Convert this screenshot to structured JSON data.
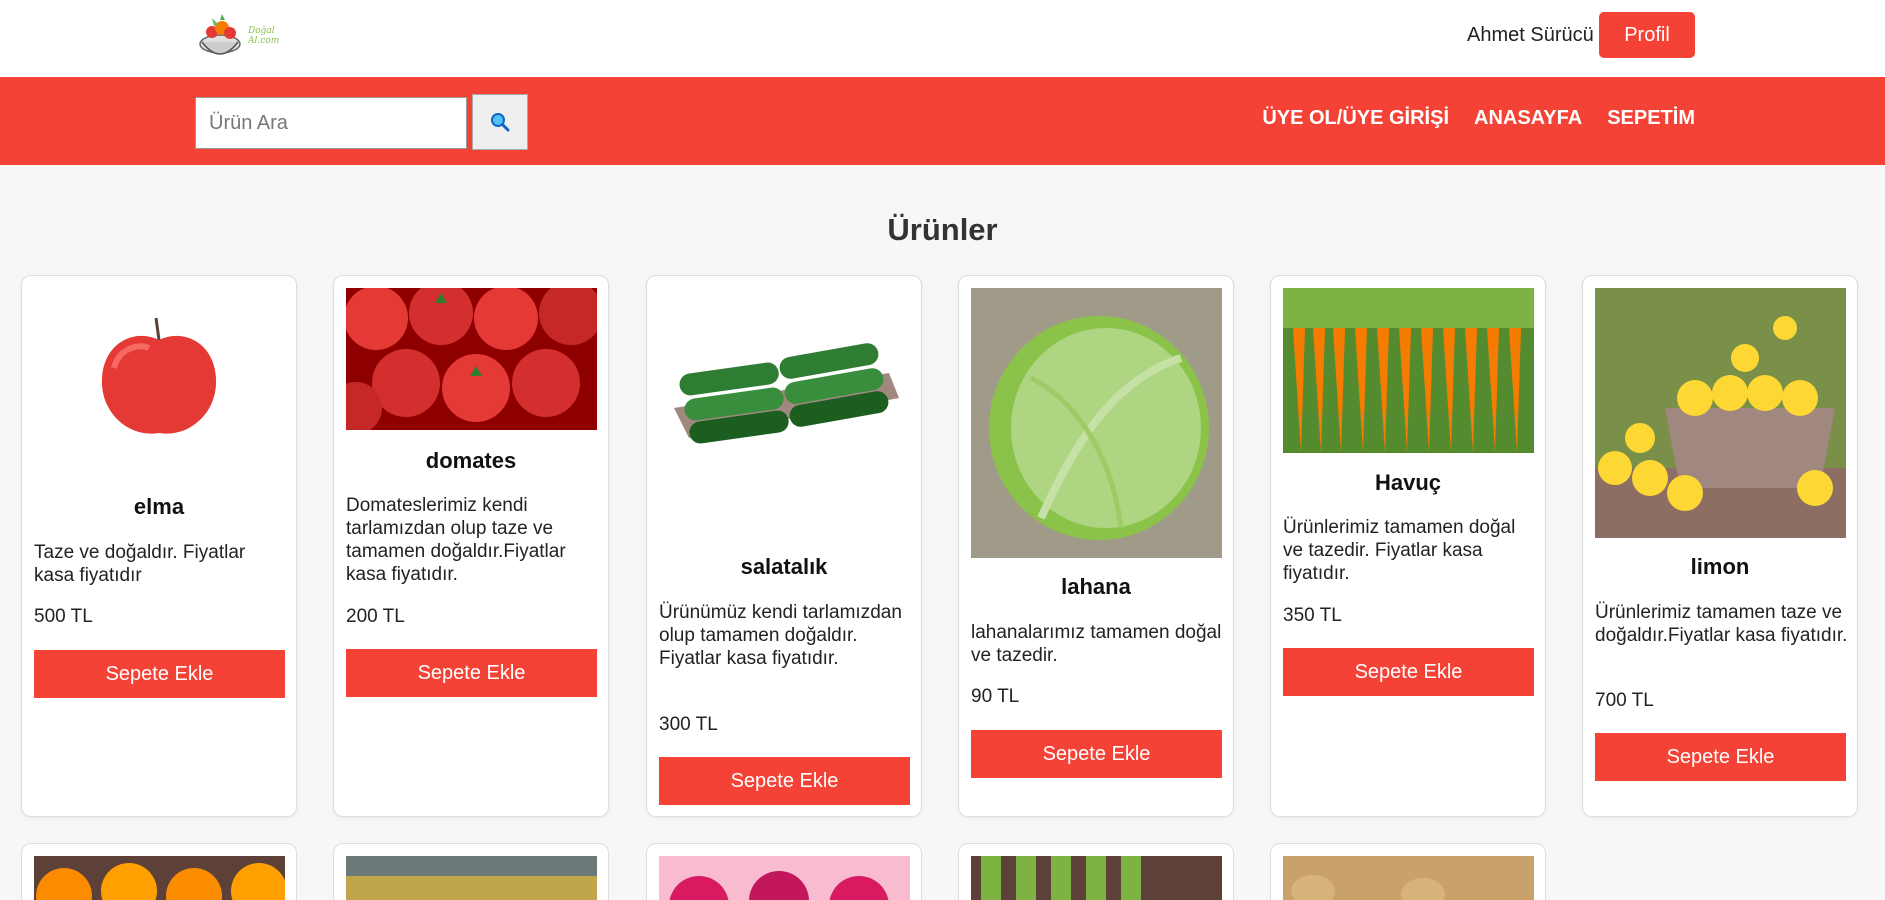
{
  "header": {
    "logo_alt": "Doğal Al.com",
    "user_name": "Ahmet Sürücü",
    "profile_label": "Profil"
  },
  "nav": {
    "search_placeholder": "Ürün Ara",
    "search_icon": "magnifier-icon",
    "links": [
      "ÜYE OL/ÜYE GİRİŞİ",
      "ANASAYFA",
      "SEPETİM"
    ]
  },
  "page_title": "Ürünler",
  "products": [
    {
      "name": "elma",
      "desc": "Taze ve doğaldır. Fiyatlar kasa fiyatıdır",
      "price": "500 TL",
      "button": "Sepete Ekle"
    },
    {
      "name": "domates",
      "desc": "Domateslerimiz kendi tarlamızdan olup taze ve tamamen doğaldır.Fiyatlar kasa fiyatıdır.",
      "price": "200 TL",
      "button": "Sepete Ekle"
    },
    {
      "name": "salatalık",
      "desc": "Ürünümüz kendi tarlamızdan olup tamamen doğaldır. Fiyatlar kasa fiyatıdır.",
      "price": "300 TL",
      "button": "Sepete Ekle"
    },
    {
      "name": "lahana",
      "desc": "lahanalarımız tamamen doğal ve tazedir.",
      "price": "90 TL",
      "button": "Sepete Ekle"
    },
    {
      "name": "Havuç",
      "desc": "Ürünlerimiz tamamen doğal ve tazedir. Fiyatlar kasa fiyatıdır.",
      "price": "350 TL",
      "button": "Sepete Ekle"
    },
    {
      "name": "limon",
      "desc": "Ürünlerimiz tamamen taze ve doğaldır.Fiyatlar kasa fiyatıdır.",
      "price": "700 TL",
      "button": "Sepete Ekle"
    }
  ],
  "colors": {
    "accent": "#f44336",
    "background": "#f7f7f7"
  }
}
